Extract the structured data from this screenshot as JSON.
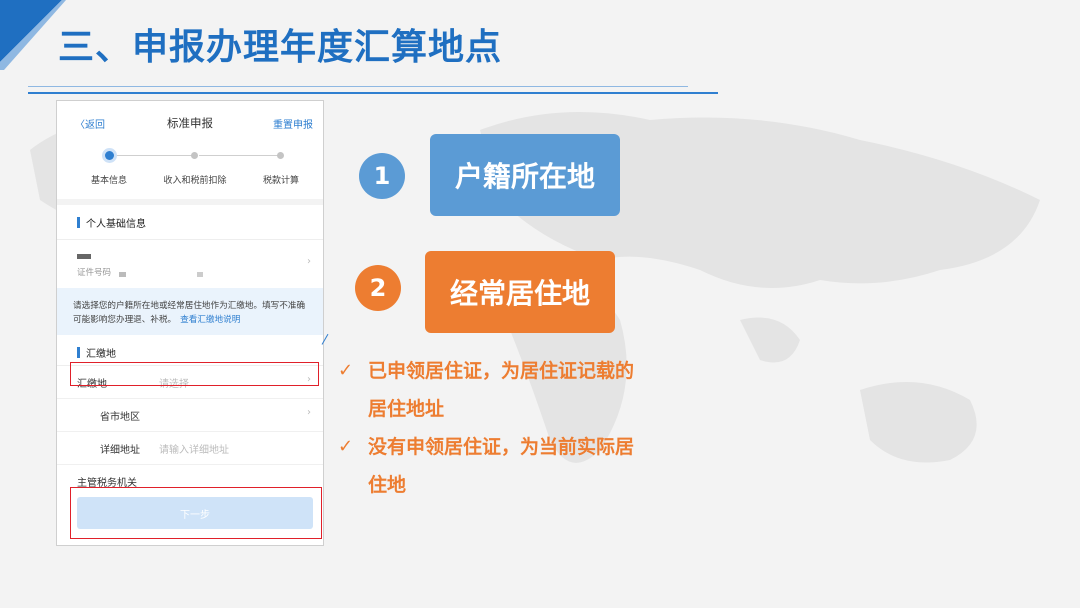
{
  "slide": {
    "title": "三、申报办理年度汇算地点"
  },
  "phone": {
    "nav": {
      "back": "〈返回",
      "title": "标准申报",
      "reset": "重置申报"
    },
    "steps": [
      "基本信息",
      "收入和税前扣除",
      "税款计算"
    ],
    "personal_section": "个人基础信息",
    "id_label": "证件号码",
    "notice_text": "请选择您的户籍所在地或经常居住地作为汇缴地。填写不准确可能影响您办理退、补税。",
    "notice_link": "查看汇缴地说明",
    "pay_section": "汇缴地",
    "rows": [
      {
        "key": "汇缴地",
        "value": "请选择"
      },
      {
        "key": "省市地区",
        "value": ""
      },
      {
        "key": "详细地址",
        "value": "请输入详细地址"
      },
      {
        "key": "主管税务机关",
        "value": ""
      }
    ],
    "next_button": "下一步"
  },
  "options": [
    {
      "number": "1",
      "label": "户籍所在地",
      "color": "#5b9bd5"
    },
    {
      "number": "2",
      "label": "经常居住地",
      "color": "#ed7d31"
    }
  ],
  "bullets": [
    {
      "check": "✓",
      "text": "已申领居住证，为居住证记载的",
      "cont": "居住地址"
    },
    {
      "check": "✓",
      "text": "没有申领居住证，为当前实际居",
      "cont": "住地"
    }
  ]
}
